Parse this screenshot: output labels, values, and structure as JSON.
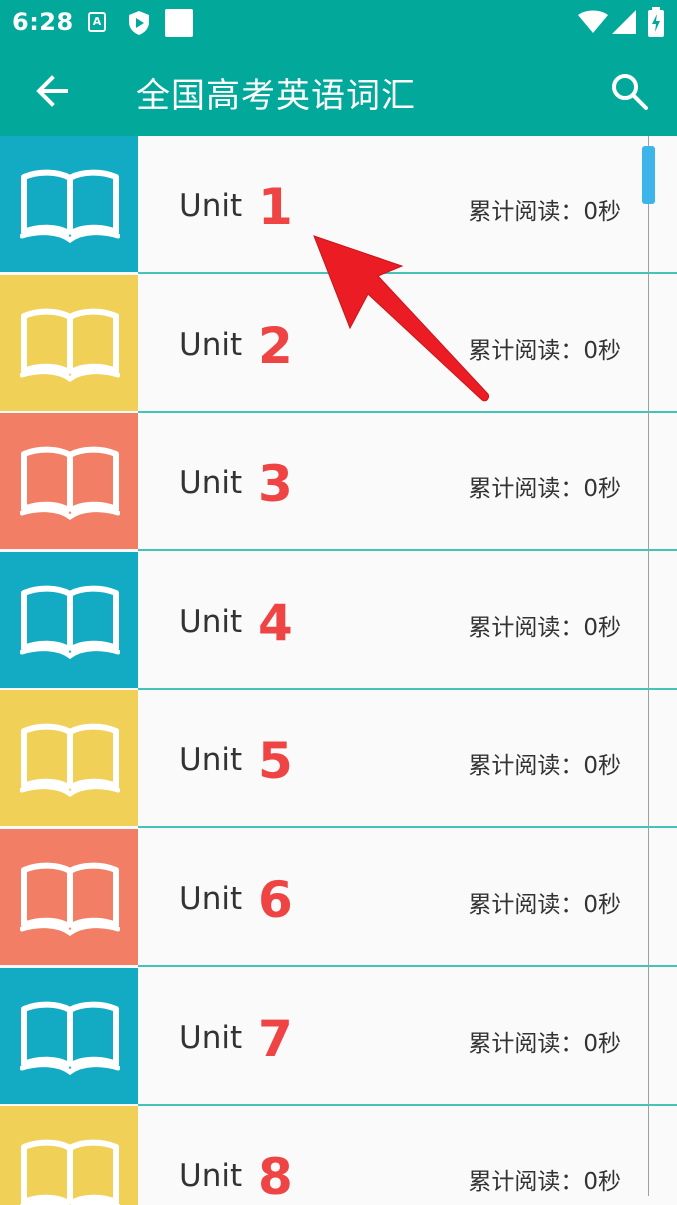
{
  "status_bar": {
    "time": "6:28",
    "icons": [
      "a-notification-icon",
      "shield-icon",
      "square-notification-icon",
      "wifi-icon",
      "signal-icon",
      "battery-charging-icon"
    ]
  },
  "app_bar": {
    "title": "全国高考英语词汇",
    "back_icon": "arrow-left-icon",
    "search_icon": "search-icon"
  },
  "list": {
    "items": [
      {
        "label": "Unit",
        "number": "1",
        "reading": "累计阅读：0秒",
        "thumb_color": "#13aac3"
      },
      {
        "label": "Unit",
        "number": "2",
        "reading": "累计阅读：0秒",
        "thumb_color": "#f0d057"
      },
      {
        "label": "Unit",
        "number": "3",
        "reading": "累计阅读：0秒",
        "thumb_color": "#f27e65"
      },
      {
        "label": "Unit",
        "number": "4",
        "reading": "累计阅读：0秒",
        "thumb_color": "#13aac3"
      },
      {
        "label": "Unit",
        "number": "5",
        "reading": "累计阅读：0秒",
        "thumb_color": "#f0d057"
      },
      {
        "label": "Unit",
        "number": "6",
        "reading": "累计阅读：0秒",
        "thumb_color": "#f27e65"
      },
      {
        "label": "Unit",
        "number": "7",
        "reading": "累计阅读：0秒",
        "thumb_color": "#13aac3"
      },
      {
        "label": "Unit",
        "number": "8",
        "reading": "累计阅读：0秒",
        "thumb_color": "#f0d057"
      }
    ]
  },
  "colors": {
    "primary": "#02a99a",
    "divider": "#44c3b8",
    "unit_number": "#ef4444",
    "scroll_thumb": "#3db4ea",
    "annotation_arrow": "#ec1c24"
  }
}
